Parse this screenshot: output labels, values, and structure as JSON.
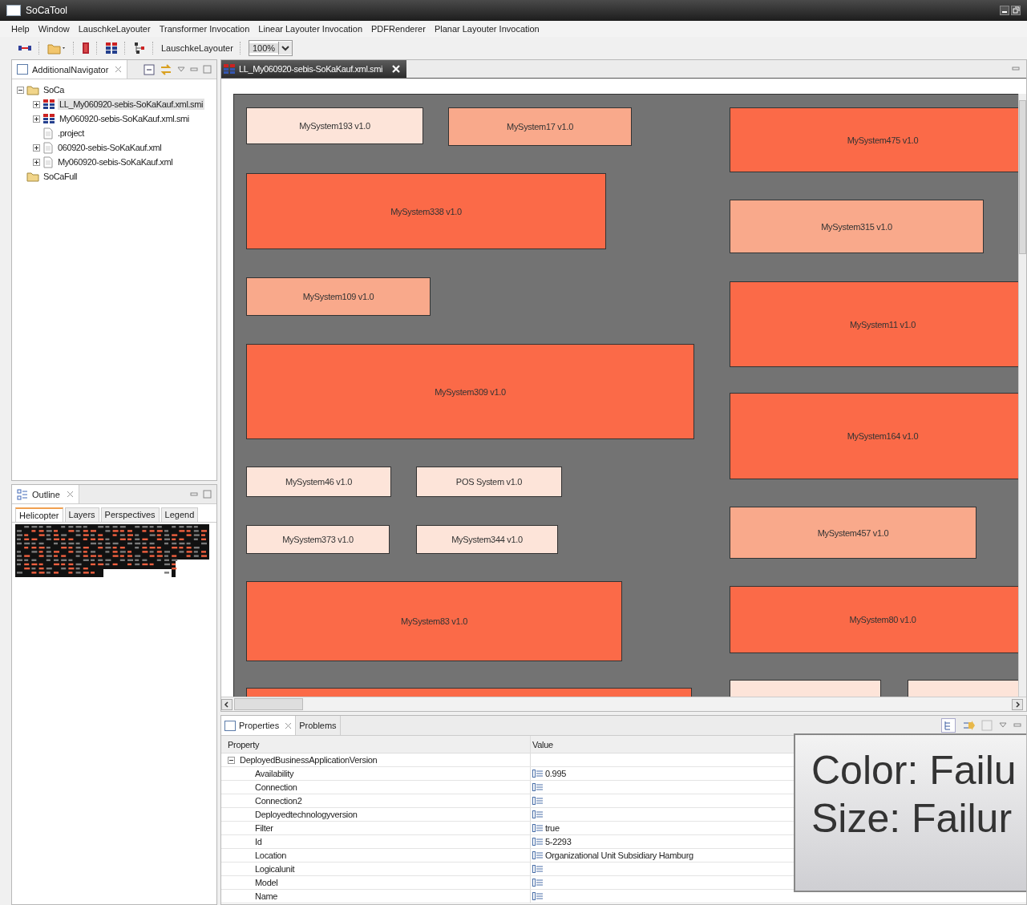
{
  "window": {
    "title": "SoCaTool"
  },
  "menu": [
    "Help",
    "Window",
    "LauschkeLayouter",
    "Transformer Invocation",
    "Linear Layouter Invocation",
    "PDFRenderer",
    "Planar Layouter Invocation"
  ],
  "toolbar": {
    "layouter_label": "LauschkeLayouter",
    "zoom": "100%"
  },
  "navigator": {
    "title": "AdditionalNavigator",
    "tree": [
      {
        "label": "SoCa",
        "kind": "folder",
        "expanded": true,
        "selected": false,
        "children": [
          {
            "label": "LL_My060920-sebis-SoKaKauf.xml.smi",
            "kind": "model",
            "expanded": false,
            "selected": true
          },
          {
            "label": "My060920-sebis-SoKaKauf.xml.smi",
            "kind": "model",
            "expanded": false,
            "selected": false
          },
          {
            "label": ".project",
            "kind": "file",
            "selected": false
          },
          {
            "label": "060920-sebis-SoKaKauf.xml",
            "kind": "file",
            "expanded": false,
            "selected": false
          },
          {
            "label": "My060920-sebis-SoKaKauf.xml",
            "kind": "file",
            "expanded": false,
            "selected": false
          }
        ]
      },
      {
        "label": "SoCaFull",
        "kind": "folder",
        "selected": false
      }
    ]
  },
  "editor": {
    "tab": "LL_My060920-sebis-SoKaKauf.xml.smi",
    "systems": [
      {
        "label": "MySystem193 v1.0",
        "color": "#fde4d9"
      },
      {
        "label": "MySystem17 v1.0",
        "color": "#f9a98b"
      },
      {
        "label": "MySystem475 v1.0",
        "color": "#fb6a48"
      },
      {
        "label": "MySystem338 v1.0",
        "color": "#fb6a48"
      },
      {
        "label": "MySystem315 v1.0",
        "color": "#f9a98b"
      },
      {
        "label": "MySystem109 v1.0",
        "color": "#f9a98b"
      },
      {
        "label": "MySystem11 v1.0",
        "color": "#fb6a48"
      },
      {
        "label": "MySystem309 v1.0",
        "color": "#fb6a48"
      },
      {
        "label": "MySystem164 v1.0",
        "color": "#fb6a48"
      },
      {
        "label": "MySystem46 v1.0",
        "color": "#fde4d9"
      },
      {
        "label": "POS System v1.0",
        "color": "#fde4d9"
      },
      {
        "label": "MySystem457 v1.0",
        "color": "#f9a98b"
      },
      {
        "label": "MySystem373 v1.0",
        "color": "#fde4d9"
      },
      {
        "label": "MySystem344 v1.0",
        "color": "#fde4d9"
      },
      {
        "label": "MySystem83 v1.0",
        "color": "#fb6a48"
      },
      {
        "label": "MySystem80 v1.0",
        "color": "#fb6a48"
      },
      {
        "color": "#fb6a48"
      },
      {
        "color": "#fde4d9"
      },
      {
        "color": "#fde4d9"
      }
    ]
  },
  "outline": {
    "title": "Outline",
    "tabs": [
      {
        "label": "Helicopter",
        "selected": true
      },
      {
        "label": "Layers",
        "selected": false
      },
      {
        "label": "Perspectives",
        "selected": false
      },
      {
        "label": "Legend",
        "selected": false
      }
    ]
  },
  "properties": {
    "tabs": [
      {
        "label": "Properties",
        "selected": true
      },
      {
        "label": "Problems",
        "selected": false
      }
    ],
    "columns": [
      "Property",
      "Value"
    ],
    "group": {
      "label": "DeployedBusinessApplicationVersion",
      "expanded": true
    },
    "rows": [
      {
        "property": "Availability",
        "value": "0.995"
      },
      {
        "property": "Connection"
      },
      {
        "property": "Connection2"
      },
      {
        "property": "Deployedtechnologyversion"
      },
      {
        "property": "Filter",
        "value": "true"
      },
      {
        "property": "Id",
        "value": "5-2293"
      },
      {
        "property": "Location",
        "value": "Organizational Unit Subsidiary Hamburg"
      },
      {
        "property": "Logicalunit"
      },
      {
        "property": "Model"
      },
      {
        "property": "Name"
      }
    ]
  },
  "tooltip": {
    "lines": [
      "Color: Failu",
      "Size: Failur"
    ]
  }
}
